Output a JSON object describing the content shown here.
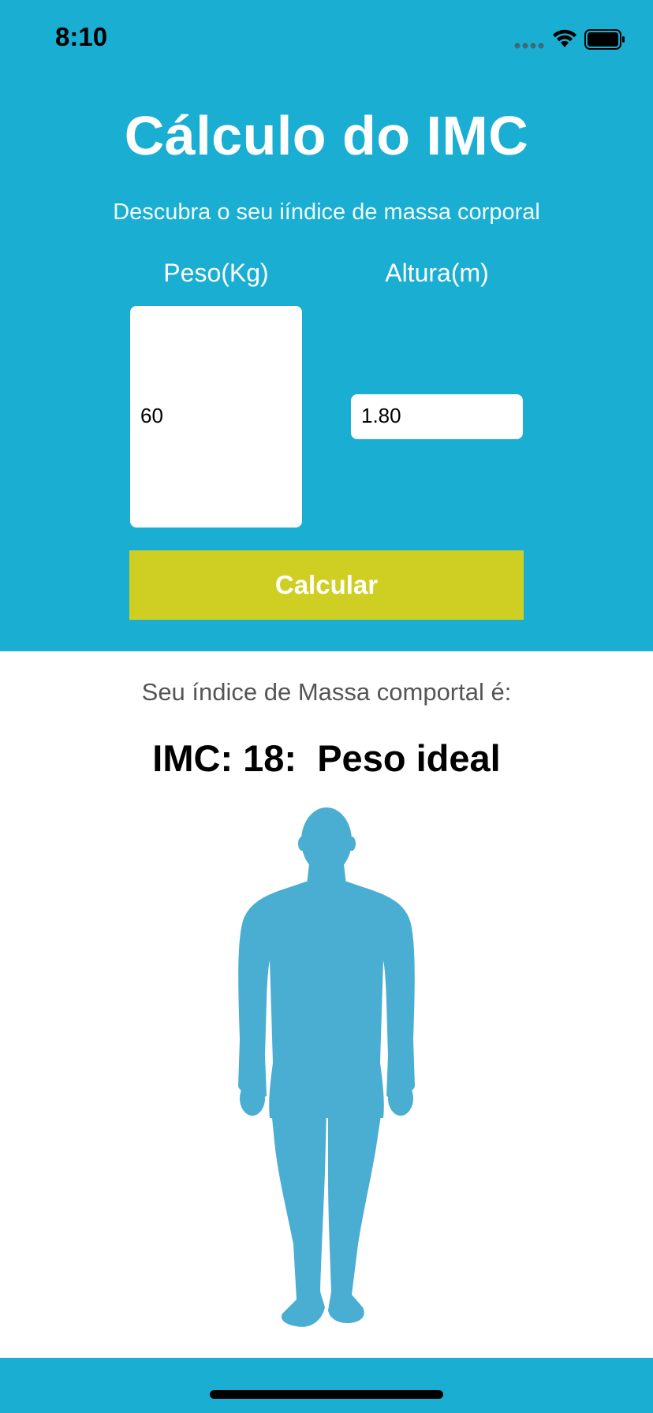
{
  "status_bar": {
    "time": "8:10"
  },
  "header": {
    "title": "Cálculo do IMC",
    "subtitle": "Descubra o seu iíndice de massa corporal"
  },
  "form": {
    "peso_label": "Peso(Kg)",
    "altura_label": "Altura(m)",
    "peso_value": "60",
    "altura_value": "1.80",
    "calc_button_label": "Calcular"
  },
  "result": {
    "caption": "Seu índice de Massa comportal é:",
    "value": "IMC: 18:  Peso ideal"
  },
  "icons": {
    "signal": "cellular-signal-icon",
    "wifi": "wifi-icon",
    "battery": "battery-icon",
    "figure": "body-silhouette-icon"
  },
  "colors": {
    "primary": "#1aaed2",
    "button": "#cfcf23",
    "silhouette": "#4aaed3",
    "input_bg": "#ffffff"
  }
}
